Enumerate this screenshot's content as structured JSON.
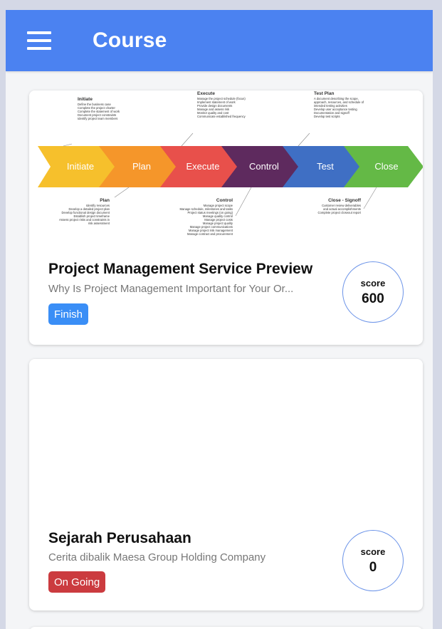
{
  "appbar": {
    "title": "Course",
    "menu_icon": "hamburger-menu-icon"
  },
  "courses": [
    {
      "title": "Project Management Service Preview",
      "subtitle": "Why Is Project Management Important for Your Or...",
      "status": "Finish",
      "status_color": "#3a8ef6",
      "score_label": "score",
      "score": "600",
      "cover": {
        "stages": [
          "Initiate",
          "Plan",
          "Execute",
          "Control",
          "Test",
          "Close"
        ],
        "stage_colors": [
          "#f6c02c",
          "#f5962a",
          "#e8504b",
          "#5e2a5e",
          "#3f6fc4",
          "#64b946"
        ],
        "notes": [
          {
            "heading": "Initiate",
            "lines": [
              "Define the business case",
              "Complete the project charter",
              "Complete the statement of work",
              "Document project constraints",
              "Identify project team members"
            ]
          },
          {
            "heading": "Execute",
            "lines": [
              "Manage the project schedule (focus)",
              "Implement statement of work",
              "Provide design documents",
              "Manage and assess risk",
              "Monitor quality and cost",
              "Communicate established frequency"
            ]
          },
          {
            "heading": "Test Plan",
            "lines": [
              "A document describing the scope,",
              "approach, resources, and schedule of",
              "intended testing activities",
              "Develop user acceptance testing",
              "Documentation and signoff",
              "Develop test scripts"
            ]
          },
          {
            "heading": "Plan",
            "lines": [
              "Identify resources",
              "Develop a detailed project plan",
              "Develop functional design document",
              "Establish project timeframe",
              "Assess project risks and constraints in",
              "risk assessment"
            ]
          },
          {
            "heading": "Control",
            "lines": [
              "Manage project scope",
              "Manage schedule, milestones and tasks",
              "Project status meetings (on going)",
              "Manage quality control",
              "Manage project costs",
              "Manage project quality",
              "Manage project communications",
              "Manage project risk management",
              "Manage contract and procurement"
            ]
          },
          {
            "heading": "Close - Signoff",
            "lines": [
              "Customer review deliverables",
              "and actual accomplishments",
              "Complete project closeout report"
            ]
          }
        ]
      }
    },
    {
      "title": "Sejarah Perusahaan",
      "subtitle": "Cerita dibalik Maesa Group Holding Company",
      "status": "On Going",
      "status_color": "#cb3b3f",
      "score_label": "score",
      "score": "0"
    }
  ]
}
